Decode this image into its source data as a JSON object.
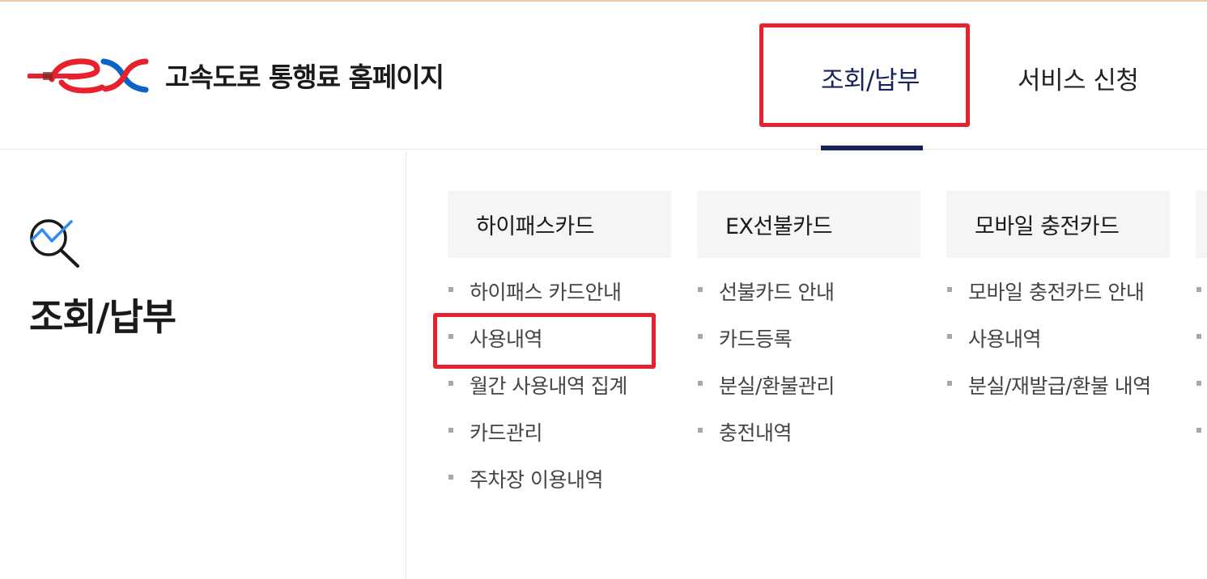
{
  "header": {
    "site_title": "고속도로 통행료 홈페이지",
    "nav": [
      {
        "label": "조회/납부",
        "active": true
      },
      {
        "label": "서비스 신청",
        "active": false
      }
    ]
  },
  "left_panel": {
    "icon": "search-chart-icon",
    "title": "조회/납부"
  },
  "menu_columns": [
    {
      "title": "하이패스카드",
      "items": [
        "하이패스 카드안내",
        "사용내역",
        "월간 사용내역 집계",
        "카드관리",
        "주차장 이용내역"
      ]
    },
    {
      "title": "EX선불카드",
      "items": [
        "선불카드 안내",
        "카드등록",
        "분실/환불관리",
        "충전내역"
      ]
    },
    {
      "title": "모바일 충전카드",
      "items": [
        "모바일 충전카드 안내",
        "사용내역",
        "분실/재발급/환불 내역"
      ]
    },
    {
      "title": "",
      "items": [
        "",
        "",
        "",
        ""
      ]
    }
  ],
  "colors": {
    "brand_red": "#e8212e",
    "brand_blue": "#0a64c8",
    "navy": "#17245a",
    "highlight": "#e8212e"
  }
}
